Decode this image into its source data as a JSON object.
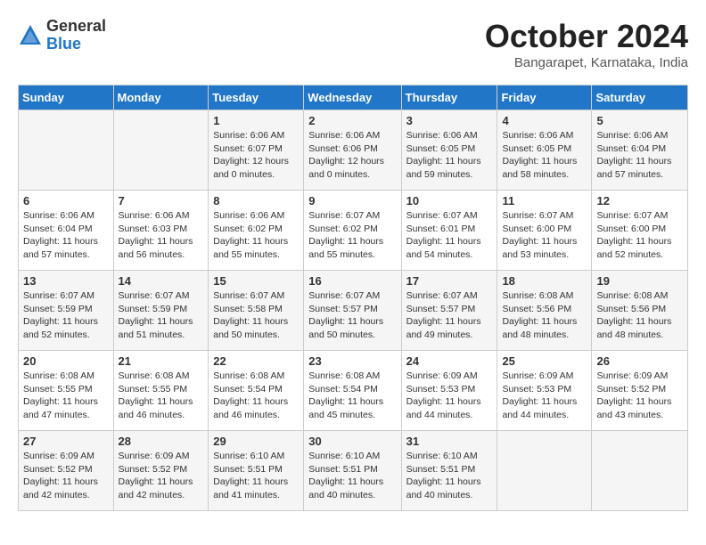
{
  "logo": {
    "general": "General",
    "blue": "Blue"
  },
  "title": "October 2024",
  "location": "Bangarapet, Karnataka, India",
  "headers": [
    "Sunday",
    "Monday",
    "Tuesday",
    "Wednesday",
    "Thursday",
    "Friday",
    "Saturday"
  ],
  "weeks": [
    [
      {
        "day": "",
        "info": ""
      },
      {
        "day": "",
        "info": ""
      },
      {
        "day": "1",
        "info": "Sunrise: 6:06 AM\nSunset: 6:07 PM\nDaylight: 12 hours\nand 0 minutes."
      },
      {
        "day": "2",
        "info": "Sunrise: 6:06 AM\nSunset: 6:06 PM\nDaylight: 12 hours\nand 0 minutes."
      },
      {
        "day": "3",
        "info": "Sunrise: 6:06 AM\nSunset: 6:05 PM\nDaylight: 11 hours\nand 59 minutes."
      },
      {
        "day": "4",
        "info": "Sunrise: 6:06 AM\nSunset: 6:05 PM\nDaylight: 11 hours\nand 58 minutes."
      },
      {
        "day": "5",
        "info": "Sunrise: 6:06 AM\nSunset: 6:04 PM\nDaylight: 11 hours\nand 57 minutes."
      }
    ],
    [
      {
        "day": "6",
        "info": "Sunrise: 6:06 AM\nSunset: 6:04 PM\nDaylight: 11 hours\nand 57 minutes."
      },
      {
        "day": "7",
        "info": "Sunrise: 6:06 AM\nSunset: 6:03 PM\nDaylight: 11 hours\nand 56 minutes."
      },
      {
        "day": "8",
        "info": "Sunrise: 6:06 AM\nSunset: 6:02 PM\nDaylight: 11 hours\nand 55 minutes."
      },
      {
        "day": "9",
        "info": "Sunrise: 6:07 AM\nSunset: 6:02 PM\nDaylight: 11 hours\nand 55 minutes."
      },
      {
        "day": "10",
        "info": "Sunrise: 6:07 AM\nSunset: 6:01 PM\nDaylight: 11 hours\nand 54 minutes."
      },
      {
        "day": "11",
        "info": "Sunrise: 6:07 AM\nSunset: 6:00 PM\nDaylight: 11 hours\nand 53 minutes."
      },
      {
        "day": "12",
        "info": "Sunrise: 6:07 AM\nSunset: 6:00 PM\nDaylight: 11 hours\nand 52 minutes."
      }
    ],
    [
      {
        "day": "13",
        "info": "Sunrise: 6:07 AM\nSunset: 5:59 PM\nDaylight: 11 hours\nand 52 minutes."
      },
      {
        "day": "14",
        "info": "Sunrise: 6:07 AM\nSunset: 5:59 PM\nDaylight: 11 hours\nand 51 minutes."
      },
      {
        "day": "15",
        "info": "Sunrise: 6:07 AM\nSunset: 5:58 PM\nDaylight: 11 hours\nand 50 minutes."
      },
      {
        "day": "16",
        "info": "Sunrise: 6:07 AM\nSunset: 5:57 PM\nDaylight: 11 hours\nand 50 minutes."
      },
      {
        "day": "17",
        "info": "Sunrise: 6:07 AM\nSunset: 5:57 PM\nDaylight: 11 hours\nand 49 minutes."
      },
      {
        "day": "18",
        "info": "Sunrise: 6:08 AM\nSunset: 5:56 PM\nDaylight: 11 hours\nand 48 minutes."
      },
      {
        "day": "19",
        "info": "Sunrise: 6:08 AM\nSunset: 5:56 PM\nDaylight: 11 hours\nand 48 minutes."
      }
    ],
    [
      {
        "day": "20",
        "info": "Sunrise: 6:08 AM\nSunset: 5:55 PM\nDaylight: 11 hours\nand 47 minutes."
      },
      {
        "day": "21",
        "info": "Sunrise: 6:08 AM\nSunset: 5:55 PM\nDaylight: 11 hours\nand 46 minutes."
      },
      {
        "day": "22",
        "info": "Sunrise: 6:08 AM\nSunset: 5:54 PM\nDaylight: 11 hours\nand 46 minutes."
      },
      {
        "day": "23",
        "info": "Sunrise: 6:08 AM\nSunset: 5:54 PM\nDaylight: 11 hours\nand 45 minutes."
      },
      {
        "day": "24",
        "info": "Sunrise: 6:09 AM\nSunset: 5:53 PM\nDaylight: 11 hours\nand 44 minutes."
      },
      {
        "day": "25",
        "info": "Sunrise: 6:09 AM\nSunset: 5:53 PM\nDaylight: 11 hours\nand 44 minutes."
      },
      {
        "day": "26",
        "info": "Sunrise: 6:09 AM\nSunset: 5:52 PM\nDaylight: 11 hours\nand 43 minutes."
      }
    ],
    [
      {
        "day": "27",
        "info": "Sunrise: 6:09 AM\nSunset: 5:52 PM\nDaylight: 11 hours\nand 42 minutes."
      },
      {
        "day": "28",
        "info": "Sunrise: 6:09 AM\nSunset: 5:52 PM\nDaylight: 11 hours\nand 42 minutes."
      },
      {
        "day": "29",
        "info": "Sunrise: 6:10 AM\nSunset: 5:51 PM\nDaylight: 11 hours\nand 41 minutes."
      },
      {
        "day": "30",
        "info": "Sunrise: 6:10 AM\nSunset: 5:51 PM\nDaylight: 11 hours\nand 40 minutes."
      },
      {
        "day": "31",
        "info": "Sunrise: 6:10 AM\nSunset: 5:51 PM\nDaylight: 11 hours\nand 40 minutes."
      },
      {
        "day": "",
        "info": ""
      },
      {
        "day": "",
        "info": ""
      }
    ]
  ]
}
